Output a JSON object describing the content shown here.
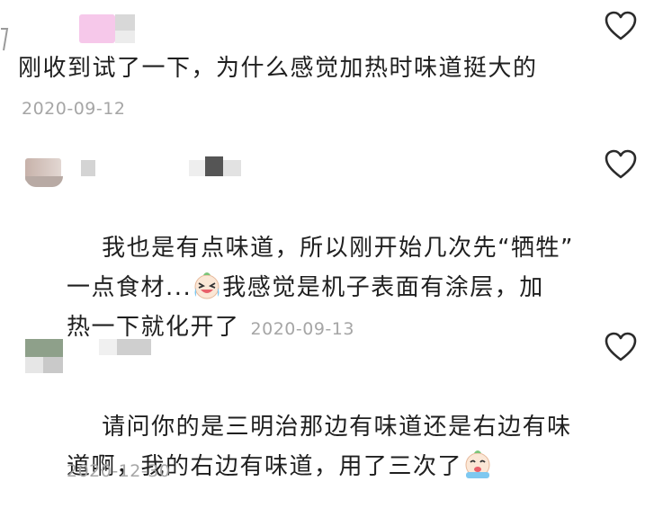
{
  "comments": [
    {
      "text": "刚收到试了一下，为什么感觉加热时味道挺大的",
      "date": "2020-09-12"
    },
    {
      "text_part1": "我也是有点味道，所以刚开始几次先“牺牲”\n一点食材...",
      "text_part2": "我感觉是机子表面有涂层，加\n热一下就化开了",
      "date": "2020-09-13",
      "emoji": "laughing-crying-emoji"
    },
    {
      "text": "请问你的是三明治那边有味道还是右边有味\n道啊，我的右边有味道，用了三次了",
      "date": "2020-12-30",
      "emoji": "crying-emoji"
    }
  ],
  "icons": {
    "like": "heart-outline-icon"
  },
  "colors": {
    "text": "#1f1f1f",
    "date": "#a6a6a6",
    "icon": "#2b2b2b"
  }
}
